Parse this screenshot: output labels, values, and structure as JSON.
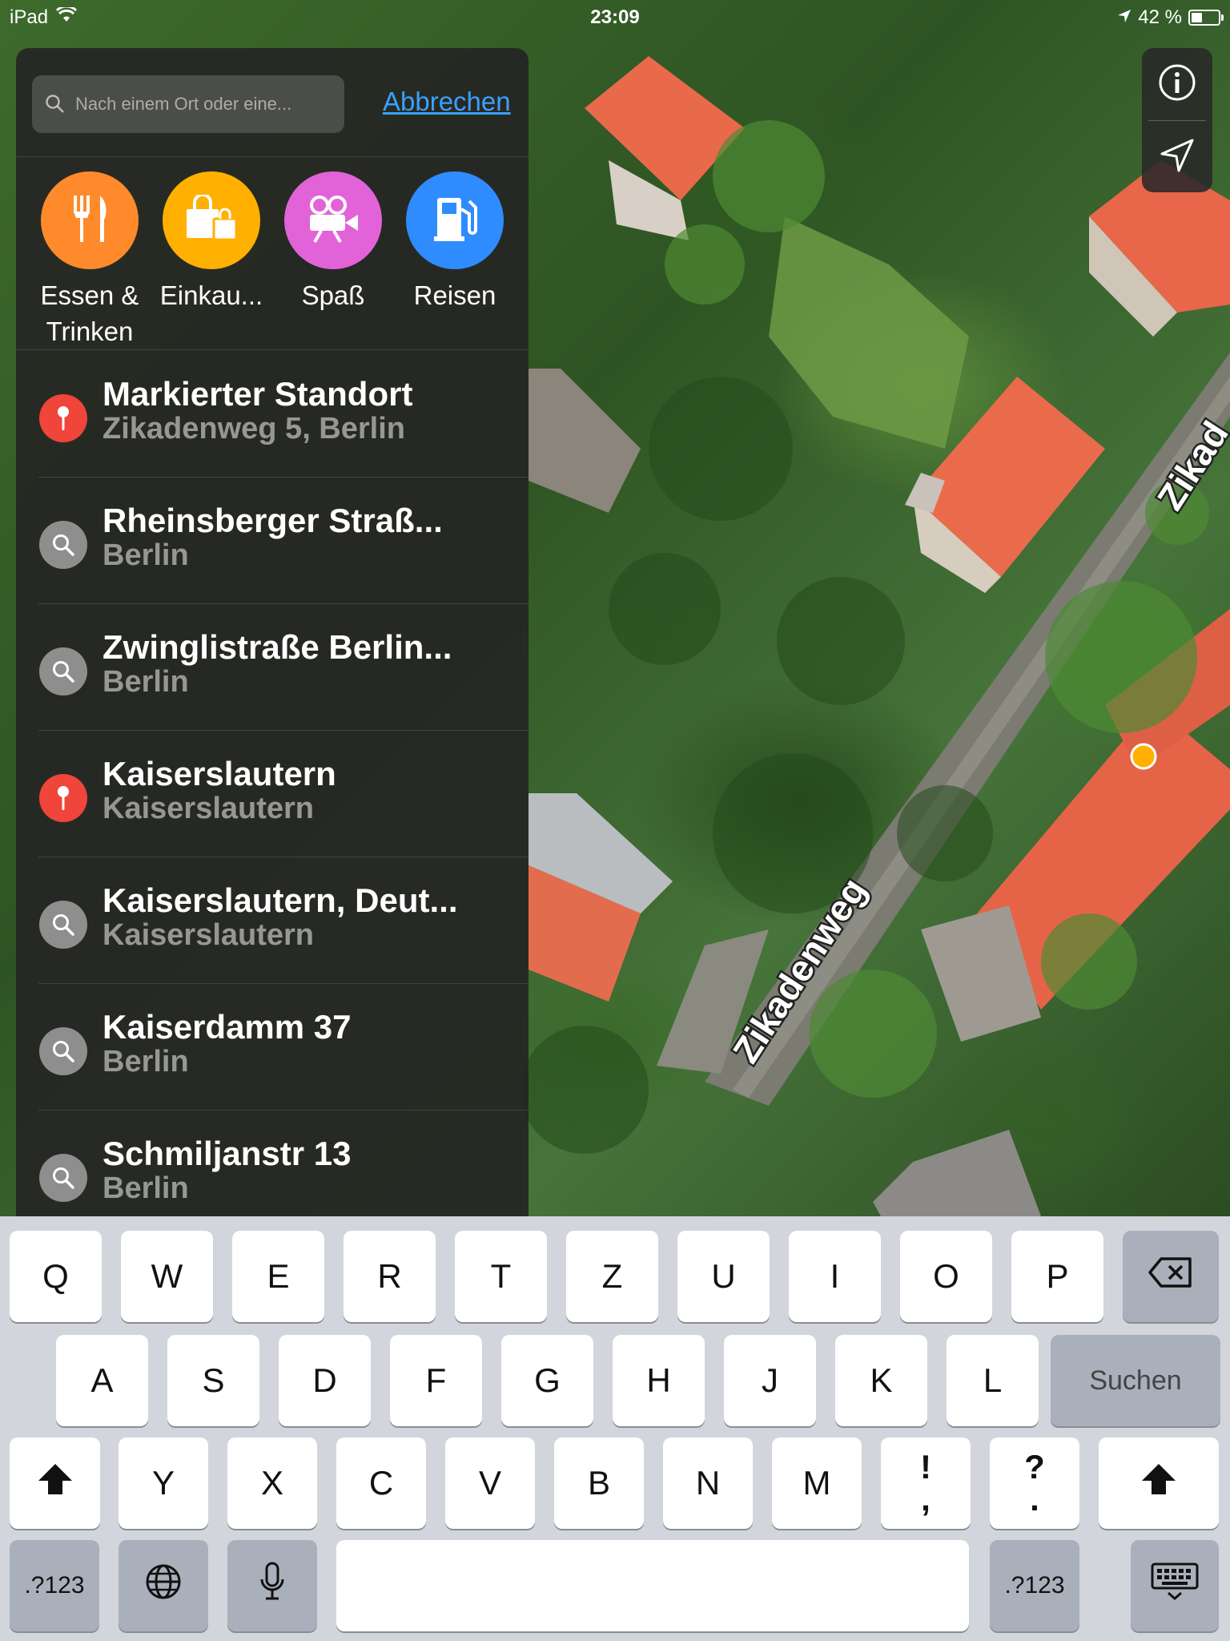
{
  "status_bar": {
    "device": "iPad",
    "time": "23:09",
    "battery": "42 %"
  },
  "map": {
    "street_labels": [
      "Zikadenweg",
      "Zikad"
    ]
  },
  "search": {
    "placeholder": "Nach einem Ort oder eine...",
    "value": "",
    "cancel_label": "Abbrechen"
  },
  "categories": [
    {
      "label": "Essen & Trinken",
      "line1": "Essen &",
      "line2": "Trinken",
      "icon": "fork-knife-icon",
      "color": "#ff8a2b"
    },
    {
      "label": "Einkau...",
      "line1": "Einkau...",
      "line2": "",
      "icon": "shopping-bag-icon",
      "color": "#ffb000"
    },
    {
      "label": "Spaß",
      "line1": "Spaß",
      "line2": "",
      "icon": "movie-camera-icon",
      "color": "#e263d8"
    },
    {
      "label": "Reisen",
      "line1": "Reisen",
      "line2": "",
      "icon": "gas-pump-icon",
      "color": "#2f8cff"
    }
  ],
  "results": [
    {
      "title": "Markierter Standort",
      "subtitle": "Zikadenweg 5, Berlin",
      "kind": "pin"
    },
    {
      "title": "Rheinsberger Straß...",
      "subtitle": "Berlin",
      "kind": "search"
    },
    {
      "title": "Zwinglistraße Berlin...",
      "subtitle": "Berlin",
      "kind": "search"
    },
    {
      "title": "Kaiserslautern",
      "subtitle": "Kaiserslautern",
      "kind": "pin"
    },
    {
      "title": "Kaiserslautern, Deut...",
      "subtitle": "Kaiserslautern",
      "kind": "search"
    },
    {
      "title": "Kaiserdamm 37",
      "subtitle": "Berlin",
      "kind": "search"
    },
    {
      "title": "Schmiljanstr 13",
      "subtitle": "Berlin",
      "kind": "search"
    }
  ],
  "keyboard": {
    "row1": [
      "Q",
      "W",
      "E",
      "R",
      "T",
      "Z",
      "U",
      "I",
      "O",
      "P"
    ],
    "row2": [
      "A",
      "S",
      "D",
      "F",
      "G",
      "H",
      "J",
      "K",
      "L"
    ],
    "row3": [
      "Y",
      "X",
      "C",
      "V",
      "B",
      "N",
      "M"
    ],
    "punct1": {
      "top": "!",
      "bottom": ","
    },
    "punct2": {
      "top": "?",
      "bottom": "."
    },
    "search_label": "Suchen",
    "numbers_label": ".?123"
  },
  "colors": {
    "accent": "#3aa0ff",
    "pin_red": "#f0453a",
    "search_gray": "#8e8e8e"
  }
}
